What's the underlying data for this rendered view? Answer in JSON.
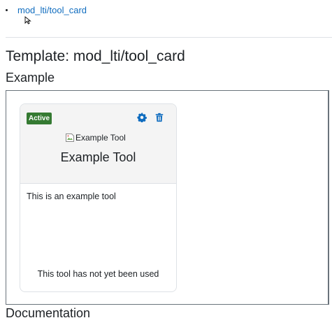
{
  "nav": {
    "link_label": "mod_lti/tool_card"
  },
  "page": {
    "title": "Template: mod_lti/tool_card",
    "example_heading": "Example",
    "documentation_heading": "Documentation"
  },
  "tool_card": {
    "status_badge": "Active",
    "image_alt": "Example Tool",
    "name": "Example Tool",
    "description": "This is an example tool",
    "usage_text": "This tool has not yet been used",
    "icons": {
      "edit": "gear-icon",
      "delete": "trash-icon"
    }
  },
  "colors": {
    "link": "#0f6cbf",
    "badge_bg": "#357a32",
    "icon": "#0f6cbf",
    "card_header_bg": "#f4f4f4"
  }
}
